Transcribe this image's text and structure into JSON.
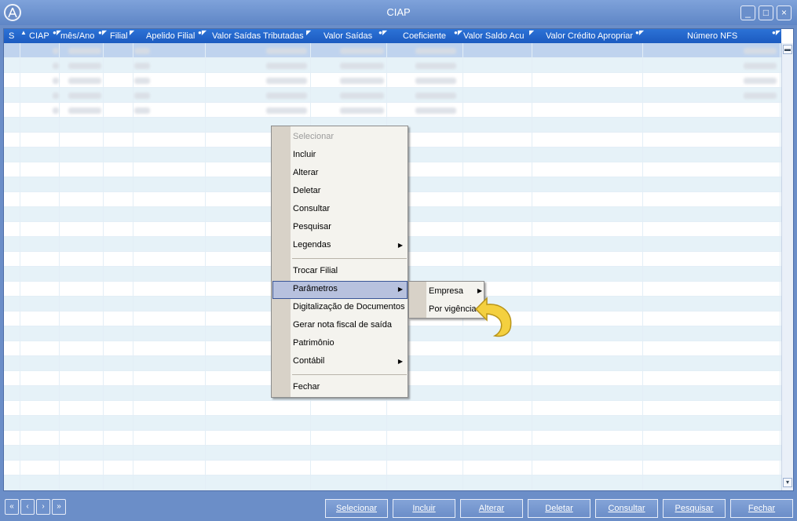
{
  "window": {
    "title": "CIAP",
    "buttons": [
      "minimize",
      "maximize",
      "close"
    ]
  },
  "grid": {
    "columns": [
      "S",
      "CIAP",
      "mês/Ano",
      "Filial",
      "Apelido Filial",
      "Valor Saídas Tributadas",
      "Valor Saídas",
      "Coeficiente",
      "Valor Saldo Acu",
      "Valor Crédito Apropriar",
      "Número NFS"
    ]
  },
  "context_menu": {
    "items": [
      "Selecionar",
      "Incluir",
      "Alterar",
      "Deletar",
      "Consultar",
      "Pesquisar",
      "Legendas",
      "Trocar Filial",
      "Parâmetros",
      "Digitalização de Documentos",
      "Gerar nota fiscal de saída",
      "Patrimônio",
      "Contábil",
      "Fechar"
    ],
    "highlighted": "Parâmetros",
    "disabled": "Selecionar"
  },
  "submenu": {
    "items": [
      "Empresa",
      "Por vigência"
    ]
  },
  "footer": {
    "nav_icons": [
      "first-page-icon",
      "previous-icon",
      "next-icon",
      "last-page-icon"
    ],
    "buttons": [
      "Selecionar",
      "Incluir",
      "Alterar",
      "Deletar",
      "Consultar",
      "Pesquisar",
      "Fechar"
    ]
  },
  "colors": {
    "frame": "#6b8ec8",
    "header": "#1c5bc0",
    "row_alt": "#e6f2f8",
    "menu_highlight": "#b7c1de"
  }
}
